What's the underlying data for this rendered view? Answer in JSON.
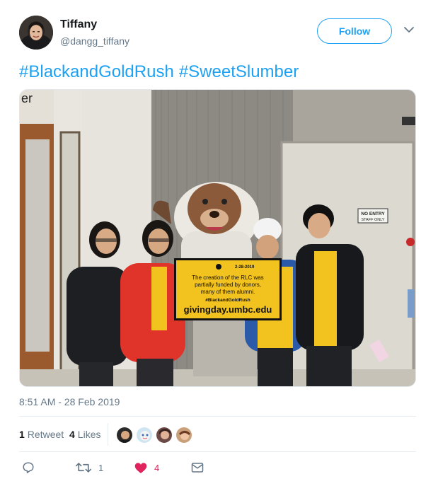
{
  "user": {
    "name": "Tiffany",
    "handle": "@dangg_tiffany",
    "follow_label": "Follow"
  },
  "tweet": {
    "hashtags": [
      "#BlackandGoldRush",
      "#SweetSlumber"
    ],
    "timestamp": "8:51 AM - 28 Feb 2019"
  },
  "photo": {
    "sign_date": "2-28-2019",
    "sign_text_1": "The creation of the RLC was",
    "sign_text_2": "partially funded by donors,",
    "sign_text_3": "many of them alumni.",
    "sign_hashtag": "#BlackandGoldRush",
    "sign_url": "givingday.umbc.edu",
    "door_sign_1": "NO ENTRY",
    "door_sign_2": "STAFF ONLY",
    "wall_letters": "er"
  },
  "stats": {
    "retweets_count": "1",
    "retweets_label": "Retweet",
    "likes_count": "4",
    "likes_label": "Likes"
  },
  "actions": {
    "reply_icon": "reply-icon",
    "retweet_count": "1",
    "like_count": "4",
    "dm_icon": "envelope-icon"
  },
  "colors": {
    "accent": "#1da1f2",
    "like": "#e0245e",
    "muted": "#657786"
  }
}
